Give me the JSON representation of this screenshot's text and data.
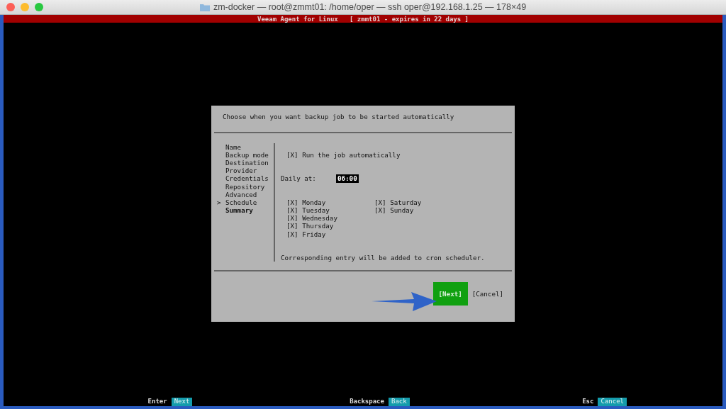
{
  "window": {
    "title": "zm-docker — root@zmmt01: /home/oper — ssh oper@192.168.1.25 — 178×49"
  },
  "header": {
    "title": "Veeam Agent for Linux   [ zmmt01 - expires in 22 days ]"
  },
  "dialog": {
    "prompt": "Choose when you want backup job to be started automatically",
    "step_pointer": ">",
    "steps": [
      {
        "label": "Name",
        "selected": false,
        "bold": false
      },
      {
        "label": "Backup mode",
        "selected": false,
        "bold": false
      },
      {
        "label": "Destination",
        "selected": false,
        "bold": false
      },
      {
        "label": "Provider",
        "selected": false,
        "bold": false
      },
      {
        "label": "Credentials",
        "selected": false,
        "bold": false
      },
      {
        "label": "Repository",
        "selected": false,
        "bold": false
      },
      {
        "label": "Advanced",
        "selected": false,
        "bold": false
      },
      {
        "label": "Schedule",
        "selected": true,
        "bold": false
      },
      {
        "label": "Summary",
        "selected": false,
        "bold": true
      }
    ],
    "run_automatically": {
      "mark": "[X]",
      "label": "Run the job automatically",
      "checked": true
    },
    "daily_label": "Daily at:",
    "daily_time": "06:00",
    "days": [
      {
        "mark": "[X]",
        "label": "Monday",
        "checked": true
      },
      {
        "mark": "[X]",
        "label": "Tuesday",
        "checked": true
      },
      {
        "mark": "[X]",
        "label": "Wednesday",
        "checked": true
      },
      {
        "mark": "[X]",
        "label": "Thursday",
        "checked": true
      },
      {
        "mark": "[X]",
        "label": "Friday",
        "checked": true
      },
      {
        "mark": "[X]",
        "label": "Saturday",
        "checked": true
      },
      {
        "mark": "[X]",
        "label": "Sunday",
        "checked": true
      }
    ],
    "note": "Corresponding entry will be added to cron scheduler.",
    "buttons": [
      {
        "label": "[Next]",
        "selected": true
      },
      {
        "label": "[Cancel]",
        "selected": false
      }
    ]
  },
  "footer": [
    {
      "key": "Enter",
      "action": "Next"
    },
    {
      "key": "Backspace",
      "action": "Back"
    },
    {
      "key": "Esc",
      "action": "Cancel"
    }
  ]
}
